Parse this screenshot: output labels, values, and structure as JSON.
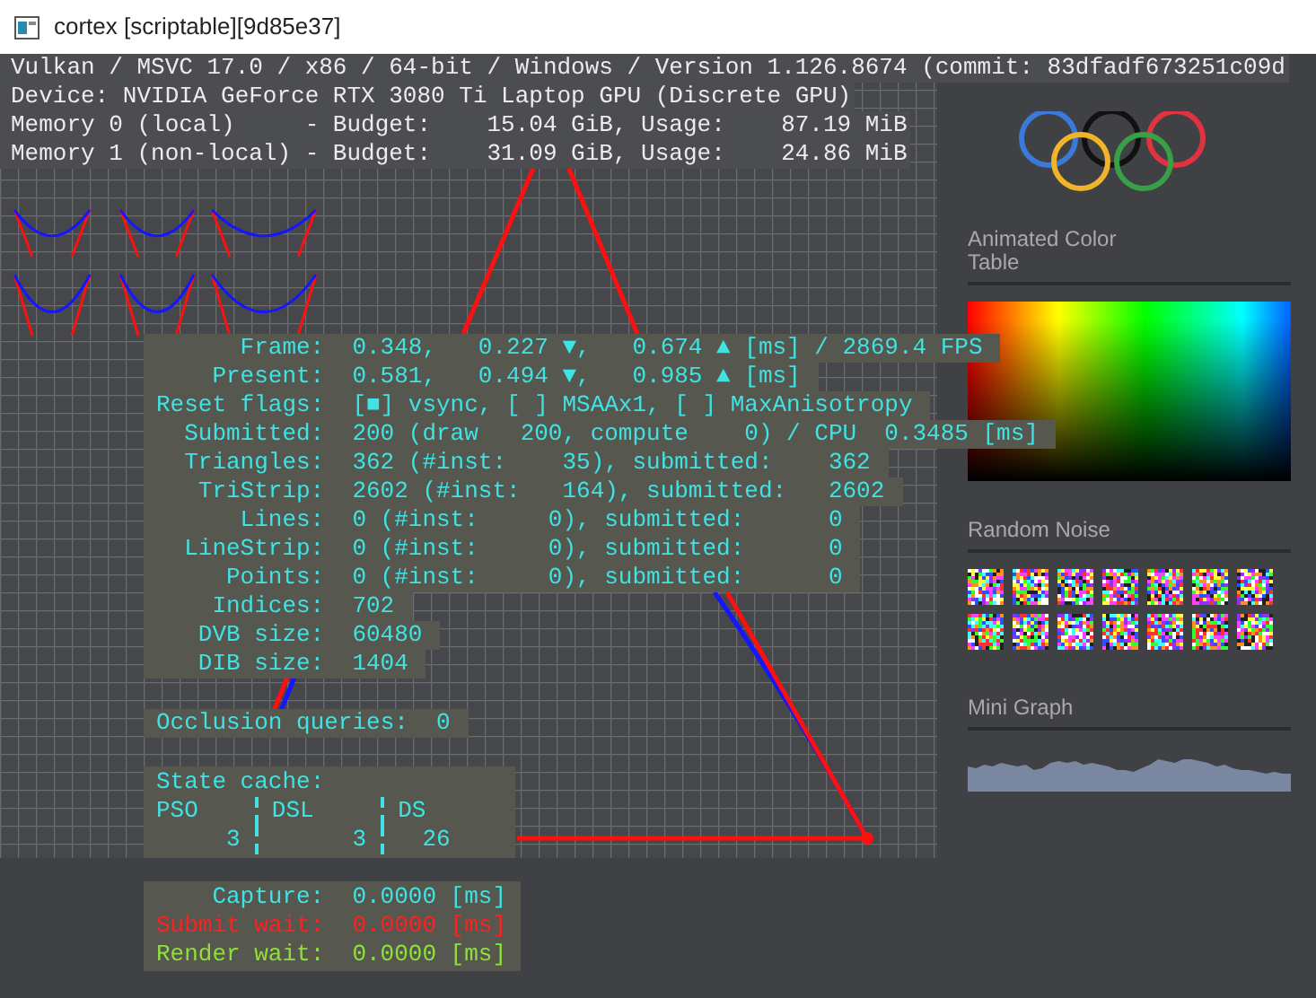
{
  "window": {
    "title": "cortex [scriptable][9d85e37]"
  },
  "header_lines": [
    "Vulkan / MSVC 17.0 / x86 / 64-bit / Windows / Version 1.126.8674 (commit: 83dfadf673251c09d",
    "Device: NVIDIA GeForce RTX 3080 Ti Laptop GPU (Discrete GPU)",
    "Memory 0 (local)     - Budget:    15.04 GiB, Usage:    87.19 MiB",
    "Memory 1 (non-local) - Budget:    31.09 GiB, Usage:    24.86 MiB"
  ],
  "stats": [
    {
      "label": "Frame:",
      "value": "0.348,   0.227 ▼,   0.674 ▲ [ms] / 2869.4 FPS"
    },
    {
      "label": "Present:",
      "value": "0.581,   0.494 ▼,   0.985 ▲ [ms]"
    },
    {
      "label": "Reset flags:",
      "value": "[■] vsync, [ ] MSAAx1, [ ] MaxAnisotropy"
    },
    {
      "label": "Submitted:",
      "value": "200 (draw   200, compute    0) / CPU  0.3485 [ms]"
    },
    {
      "label": "Triangles:",
      "value": "362 (#inst:    35), submitted:    362"
    },
    {
      "label": "TriStrip:",
      "value": "2602 (#inst:   164), submitted:   2602"
    },
    {
      "label": "Lines:",
      "value": "0 (#inst:     0), submitted:      0"
    },
    {
      "label": "LineStrip:",
      "value": "0 (#inst:     0), submitted:      0"
    },
    {
      "label": "Points:",
      "value": "0 (#inst:     0), submitted:      0"
    },
    {
      "label": "Indices:",
      "value": "702"
    },
    {
      "label": "DVB size:",
      "value": "60480"
    },
    {
      "label": "DIB size:",
      "value": "1404"
    }
  ],
  "occlusion": {
    "label": "Occlusion queries:",
    "value": "0"
  },
  "state_cache": {
    "title": "State cache:",
    "columns": [
      "PSO",
      "DSL",
      "DS"
    ],
    "values": [
      "3",
      "3",
      "26"
    ]
  },
  "timings": [
    {
      "label": "Capture:",
      "value": "0.0000 [ms]",
      "color": "#3fe3e3"
    },
    {
      "label": "Submit wait:",
      "value": "0.0000 [ms]",
      "color": "#ff2020"
    },
    {
      "label": "Render wait:",
      "value": "0.0000 [ms]",
      "color": "#8fe03a"
    }
  ],
  "sidebar": {
    "sections": [
      {
        "kind": "logo"
      },
      {
        "kind": "gradient",
        "title": "Animated Color Table"
      },
      {
        "kind": "noise",
        "title": "Random Noise"
      },
      {
        "kind": "graph",
        "title": "Mini Graph"
      }
    ]
  }
}
